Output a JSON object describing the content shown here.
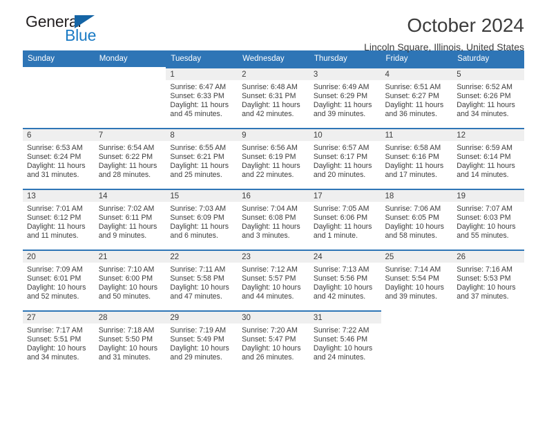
{
  "brand": {
    "name_top": "General",
    "name_bottom": "Blue",
    "triangle_color": "#1464a5",
    "blue_text_color": "#1a7ac4"
  },
  "header": {
    "title": "October 2024",
    "subtitle": "Lincoln Square, Illinois, United States"
  },
  "theme": {
    "header_bg": "#2e75b6",
    "daynum_bg": "#efefef",
    "text": "#3c3c3c"
  },
  "weekdays": [
    "Sunday",
    "Monday",
    "Tuesday",
    "Wednesday",
    "Thursday",
    "Friday",
    "Saturday"
  ],
  "weeks": [
    [
      {
        "day": "",
        "empty": true
      },
      {
        "day": "",
        "empty": true
      },
      {
        "day": "1",
        "sunrise": "Sunrise: 6:47 AM",
        "sunset": "Sunset: 6:33 PM",
        "daylight": "Daylight: 11 hours and 45 minutes."
      },
      {
        "day": "2",
        "sunrise": "Sunrise: 6:48 AM",
        "sunset": "Sunset: 6:31 PM",
        "daylight": "Daylight: 11 hours and 42 minutes."
      },
      {
        "day": "3",
        "sunrise": "Sunrise: 6:49 AM",
        "sunset": "Sunset: 6:29 PM",
        "daylight": "Daylight: 11 hours and 39 minutes."
      },
      {
        "day": "4",
        "sunrise": "Sunrise: 6:51 AM",
        "sunset": "Sunset: 6:27 PM",
        "daylight": "Daylight: 11 hours and 36 minutes."
      },
      {
        "day": "5",
        "sunrise": "Sunrise: 6:52 AM",
        "sunset": "Sunset: 6:26 PM",
        "daylight": "Daylight: 11 hours and 34 minutes."
      }
    ],
    [
      {
        "day": "6",
        "sunrise": "Sunrise: 6:53 AM",
        "sunset": "Sunset: 6:24 PM",
        "daylight": "Daylight: 11 hours and 31 minutes."
      },
      {
        "day": "7",
        "sunrise": "Sunrise: 6:54 AM",
        "sunset": "Sunset: 6:22 PM",
        "daylight": "Daylight: 11 hours and 28 minutes."
      },
      {
        "day": "8",
        "sunrise": "Sunrise: 6:55 AM",
        "sunset": "Sunset: 6:21 PM",
        "daylight": "Daylight: 11 hours and 25 minutes."
      },
      {
        "day": "9",
        "sunrise": "Sunrise: 6:56 AM",
        "sunset": "Sunset: 6:19 PM",
        "daylight": "Daylight: 11 hours and 22 minutes."
      },
      {
        "day": "10",
        "sunrise": "Sunrise: 6:57 AM",
        "sunset": "Sunset: 6:17 PM",
        "daylight": "Daylight: 11 hours and 20 minutes."
      },
      {
        "day": "11",
        "sunrise": "Sunrise: 6:58 AM",
        "sunset": "Sunset: 6:16 PM",
        "daylight": "Daylight: 11 hours and 17 minutes."
      },
      {
        "day": "12",
        "sunrise": "Sunrise: 6:59 AM",
        "sunset": "Sunset: 6:14 PM",
        "daylight": "Daylight: 11 hours and 14 minutes."
      }
    ],
    [
      {
        "day": "13",
        "sunrise": "Sunrise: 7:01 AM",
        "sunset": "Sunset: 6:12 PM",
        "daylight": "Daylight: 11 hours and 11 minutes."
      },
      {
        "day": "14",
        "sunrise": "Sunrise: 7:02 AM",
        "sunset": "Sunset: 6:11 PM",
        "daylight": "Daylight: 11 hours and 9 minutes."
      },
      {
        "day": "15",
        "sunrise": "Sunrise: 7:03 AM",
        "sunset": "Sunset: 6:09 PM",
        "daylight": "Daylight: 11 hours and 6 minutes."
      },
      {
        "day": "16",
        "sunrise": "Sunrise: 7:04 AM",
        "sunset": "Sunset: 6:08 PM",
        "daylight": "Daylight: 11 hours and 3 minutes."
      },
      {
        "day": "17",
        "sunrise": "Sunrise: 7:05 AM",
        "sunset": "Sunset: 6:06 PM",
        "daylight": "Daylight: 11 hours and 1 minute."
      },
      {
        "day": "18",
        "sunrise": "Sunrise: 7:06 AM",
        "sunset": "Sunset: 6:05 PM",
        "daylight": "Daylight: 10 hours and 58 minutes."
      },
      {
        "day": "19",
        "sunrise": "Sunrise: 7:07 AM",
        "sunset": "Sunset: 6:03 PM",
        "daylight": "Daylight: 10 hours and 55 minutes."
      }
    ],
    [
      {
        "day": "20",
        "sunrise": "Sunrise: 7:09 AM",
        "sunset": "Sunset: 6:01 PM",
        "daylight": "Daylight: 10 hours and 52 minutes."
      },
      {
        "day": "21",
        "sunrise": "Sunrise: 7:10 AM",
        "sunset": "Sunset: 6:00 PM",
        "daylight": "Daylight: 10 hours and 50 minutes."
      },
      {
        "day": "22",
        "sunrise": "Sunrise: 7:11 AM",
        "sunset": "Sunset: 5:58 PM",
        "daylight": "Daylight: 10 hours and 47 minutes."
      },
      {
        "day": "23",
        "sunrise": "Sunrise: 7:12 AM",
        "sunset": "Sunset: 5:57 PM",
        "daylight": "Daylight: 10 hours and 44 minutes."
      },
      {
        "day": "24",
        "sunrise": "Sunrise: 7:13 AM",
        "sunset": "Sunset: 5:56 PM",
        "daylight": "Daylight: 10 hours and 42 minutes."
      },
      {
        "day": "25",
        "sunrise": "Sunrise: 7:14 AM",
        "sunset": "Sunset: 5:54 PM",
        "daylight": "Daylight: 10 hours and 39 minutes."
      },
      {
        "day": "26",
        "sunrise": "Sunrise: 7:16 AM",
        "sunset": "Sunset: 5:53 PM",
        "daylight": "Daylight: 10 hours and 37 minutes."
      }
    ],
    [
      {
        "day": "27",
        "sunrise": "Sunrise: 7:17 AM",
        "sunset": "Sunset: 5:51 PM",
        "daylight": "Daylight: 10 hours and 34 minutes."
      },
      {
        "day": "28",
        "sunrise": "Sunrise: 7:18 AM",
        "sunset": "Sunset: 5:50 PM",
        "daylight": "Daylight: 10 hours and 31 minutes."
      },
      {
        "day": "29",
        "sunrise": "Sunrise: 7:19 AM",
        "sunset": "Sunset: 5:49 PM",
        "daylight": "Daylight: 10 hours and 29 minutes."
      },
      {
        "day": "30",
        "sunrise": "Sunrise: 7:20 AM",
        "sunset": "Sunset: 5:47 PM",
        "daylight": "Daylight: 10 hours and 26 minutes."
      },
      {
        "day": "31",
        "sunrise": "Sunrise: 7:22 AM",
        "sunset": "Sunset: 5:46 PM",
        "daylight": "Daylight: 10 hours and 24 minutes."
      },
      {
        "day": "",
        "empty": true
      },
      {
        "day": "",
        "empty": true
      }
    ]
  ]
}
